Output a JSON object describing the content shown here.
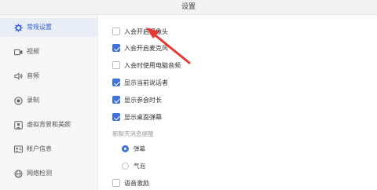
{
  "window": {
    "title": "设置"
  },
  "sidebar": {
    "items": [
      {
        "label": "常规设置",
        "icon": "gear-icon",
        "active": true
      },
      {
        "label": "视频",
        "icon": "video-icon"
      },
      {
        "label": "音频",
        "icon": "audio-icon"
      },
      {
        "label": "录制",
        "icon": "record-icon"
      },
      {
        "label": "虚拟背景和美颜",
        "icon": "virtual-background-icon"
      },
      {
        "label": "帐户信息",
        "icon": "account-icon"
      },
      {
        "label": "网络检测",
        "icon": "network-icon"
      }
    ]
  },
  "settings": {
    "options": [
      {
        "label": "入会开启摄像头",
        "checked": false
      },
      {
        "label": "入会开启麦克风",
        "checked": true
      },
      {
        "label": "入会时使用电脑音频",
        "checked": false
      },
      {
        "label": "显示当前说话者",
        "checked": true
      },
      {
        "label": "显示参会时长",
        "checked": true
      },
      {
        "label": "显示桌面弹幕",
        "checked": true
      }
    ],
    "chat_section": {
      "label": "新聊天消息提醒",
      "radios": [
        {
          "label": "弹幕",
          "selected": true
        },
        {
          "label": "气泡",
          "selected": false
        }
      ]
    },
    "extra_options": [
      {
        "label": "语音激励",
        "checked": false
      }
    ]
  },
  "colors": {
    "accent": "#3f73d9",
    "annotation_arrow": "#e53935",
    "sidebar_bg": "#f7f7f8",
    "active_bg": "#e9eef6"
  }
}
